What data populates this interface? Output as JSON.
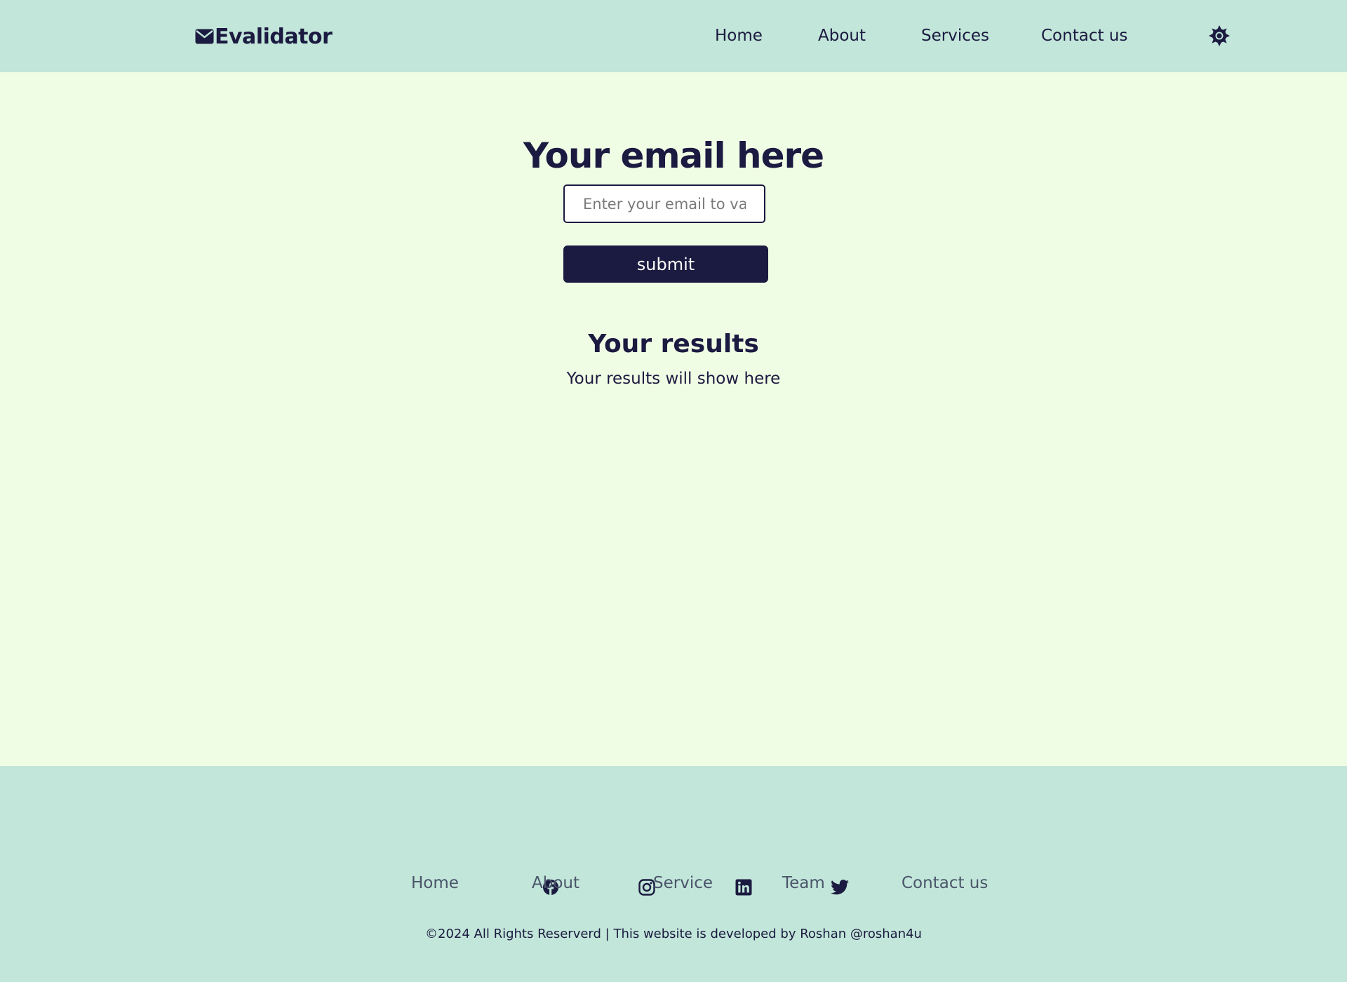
{
  "header": {
    "brand": "Evalidator",
    "nav": [
      {
        "label": "Home"
      },
      {
        "label": "About"
      },
      {
        "label": "Services"
      },
      {
        "label": "Contact us"
      }
    ],
    "theme_icon": "sun-icon"
  },
  "main": {
    "title": "Your email here",
    "input_placeholder": "Enter your email to validate",
    "input_value": "",
    "submit_label": "submit",
    "results_title": "Your results",
    "results_text": "Your results will show here"
  },
  "footer": {
    "social": [
      {
        "icon": "facebook-icon"
      },
      {
        "icon": "instagram-icon"
      },
      {
        "icon": "linkedin-icon"
      },
      {
        "icon": "twitter-icon"
      }
    ],
    "links": [
      {
        "label": "Home"
      },
      {
        "label": "About"
      },
      {
        "label": "Service"
      },
      {
        "label": "Team"
      },
      {
        "label": "Contact us"
      }
    ],
    "copyright": "©2024 All Rights Reserverd | This website is developed by Roshan @roshan4u"
  },
  "colors": {
    "header_bg": "#c2e6d9",
    "page_bg": "#f0fde5",
    "primary": "#1b1a40",
    "footer_link": "#4a556a"
  }
}
